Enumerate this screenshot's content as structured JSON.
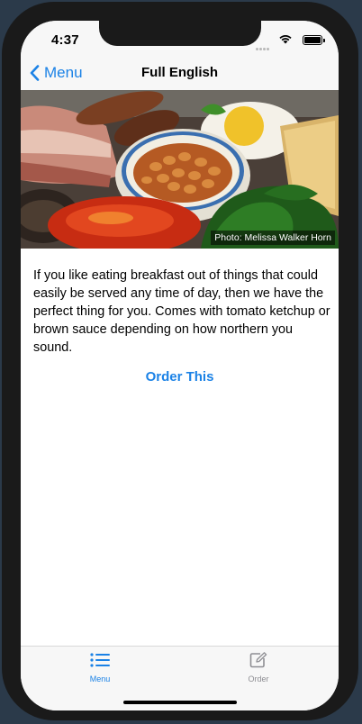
{
  "status_bar": {
    "time": "4:37"
  },
  "nav": {
    "back_label": "Menu",
    "title": "Full English"
  },
  "hero": {
    "photo_credit": "Photo: Melissa Walker Horn"
  },
  "content": {
    "description": "If you like eating breakfast out of things that could easily be served any time of day, then we have the perfect thing for you. Comes with tomato ketchup or brown sauce depending on how northern you sound.",
    "order_button_label": "Order This"
  },
  "tab_bar": {
    "tabs": [
      {
        "label": "Menu",
        "icon": "list-icon",
        "selected": true
      },
      {
        "label": "Order",
        "icon": "compose-icon",
        "selected": false
      }
    ]
  },
  "colors": {
    "accent": "#1b82e6",
    "inactive": "#8e8e93"
  }
}
